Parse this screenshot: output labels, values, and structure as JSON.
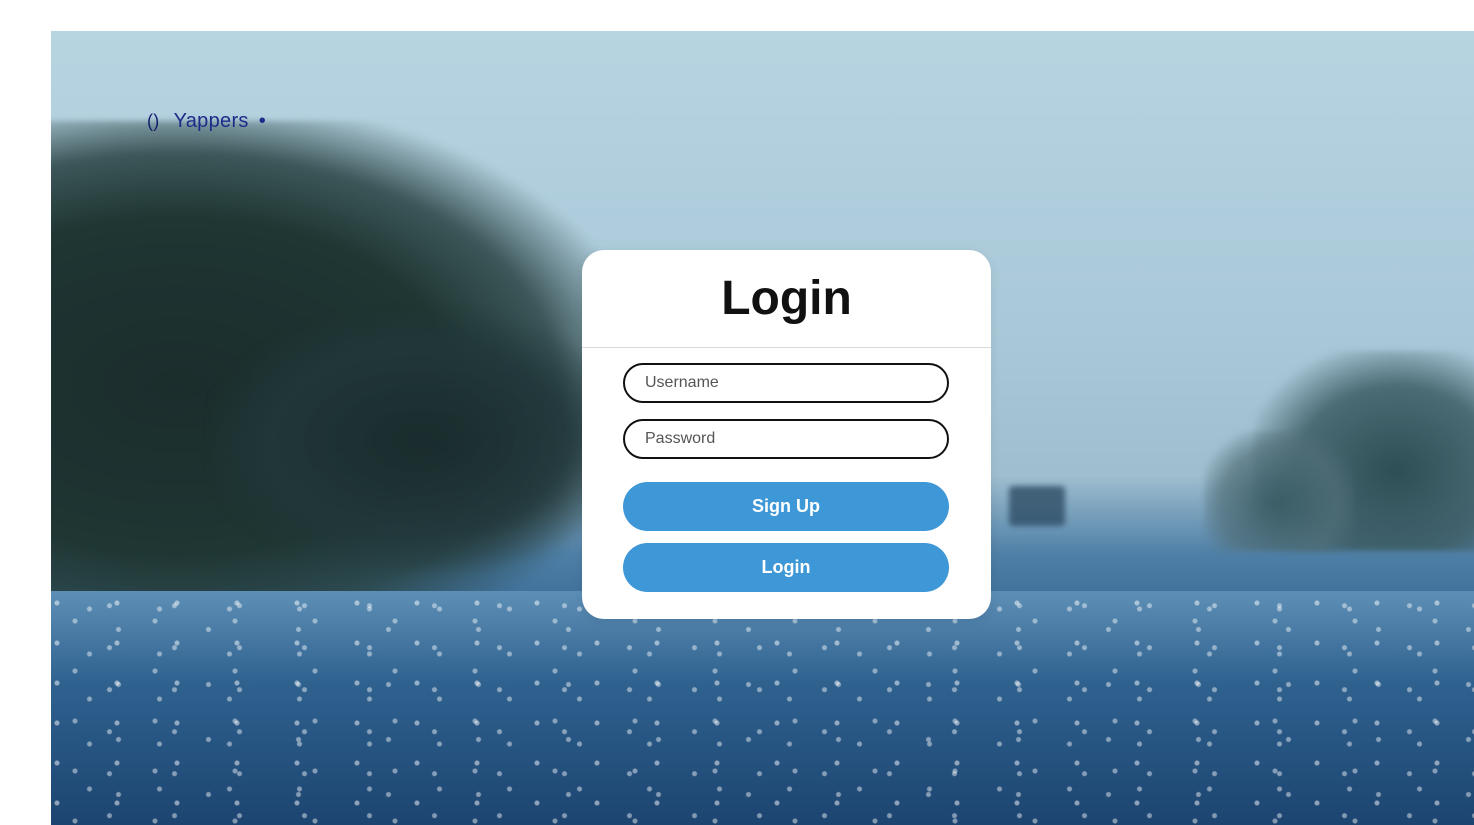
{
  "brand": {
    "icon": "parentheses-icon",
    "icon_glyph": "()",
    "name": "Yappers",
    "dot": "•"
  },
  "login_form": {
    "title": "Login",
    "username_placeholder": "Username",
    "password_placeholder": "Password",
    "signup_label": "Sign Up",
    "login_label": "Login"
  },
  "colors": {
    "button": "#3e97d6",
    "brand_text": "#1f2a8a",
    "card": "#ffffff"
  }
}
